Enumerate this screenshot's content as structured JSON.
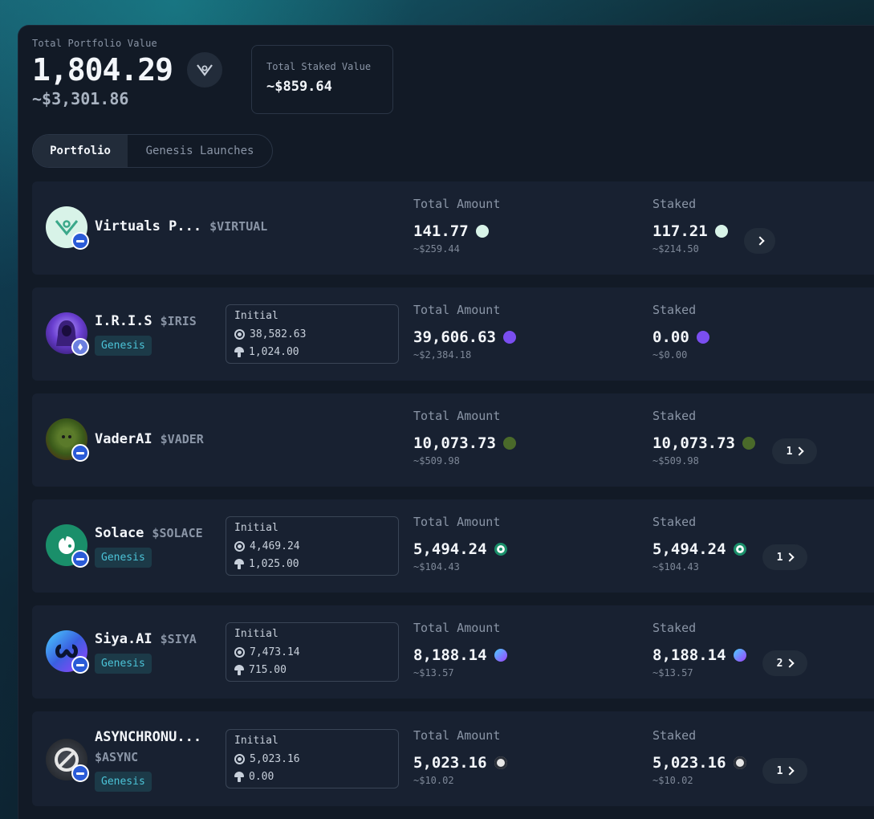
{
  "header": {
    "total_portfolio_label": "Total Portfolio Value",
    "total_portfolio_value": "1,804.29",
    "total_portfolio_usd": "~$3,301.86",
    "staked_label": "Total Staked Value",
    "staked_value": "~$859.64"
  },
  "tabs": [
    {
      "label": "Portfolio",
      "active": true
    },
    {
      "label": "Genesis Launches",
      "active": false
    }
  ],
  "columns": {
    "total": "Total Amount",
    "staked": "Staked"
  },
  "initial_label": "Initial",
  "genesis_label": "Genesis",
  "assets": [
    {
      "name": "Virtuals P...",
      "ticker": "$VIRTUAL",
      "total": "141.77",
      "total_usd": "~$259.44",
      "staked": "117.21",
      "staked_usd": "~$214.50",
      "count": "",
      "color": "#d8f3e8"
    },
    {
      "name": "I.R.I.S",
      "ticker": "$IRIS",
      "genesis": true,
      "initial_a": "38,582.63",
      "initial_b": "1,024.00",
      "total": "39,606.63",
      "total_usd": "~$2,384.18",
      "staked": "0.00",
      "staked_usd": "~$0.00",
      "count": null,
      "color": "#6a3fd0"
    },
    {
      "name": "VaderAI",
      "ticker": "$VADER",
      "total": "10,073.73",
      "total_usd": "~$509.98",
      "staked": "10,073.73",
      "staked_usd": "~$509.98",
      "count": "1",
      "color": "#4a6a2a"
    },
    {
      "name": "Solace",
      "ticker": "$SOLACE",
      "genesis": true,
      "initial_a": "4,469.24",
      "initial_b": "1,025.00",
      "total": "5,494.24",
      "total_usd": "~$104.43",
      "staked": "5,494.24",
      "staked_usd": "~$104.43",
      "count": "1",
      "color": "#1a8f6a"
    },
    {
      "name": "Siya.AI",
      "ticker": "$SIYA",
      "genesis": true,
      "initial_a": "7,473.14",
      "initial_b": "715.00",
      "total": "8,188.14",
      "total_usd": "~$13.57",
      "staked": "8,188.14",
      "staked_usd": "~$13.57",
      "count": "2",
      "color": "#3a5fe0"
    },
    {
      "name": "ASYNCHRONU...",
      "ticker": "$ASYNC",
      "genesis": true,
      "initial_a": "5,023.16",
      "initial_b": "0.00",
      "total": "5,023.16",
      "total_usd": "~$10.02",
      "staked": "5,023.16",
      "staked_usd": "~$10.02",
      "count": "1",
      "color": "#2a2f38"
    }
  ]
}
